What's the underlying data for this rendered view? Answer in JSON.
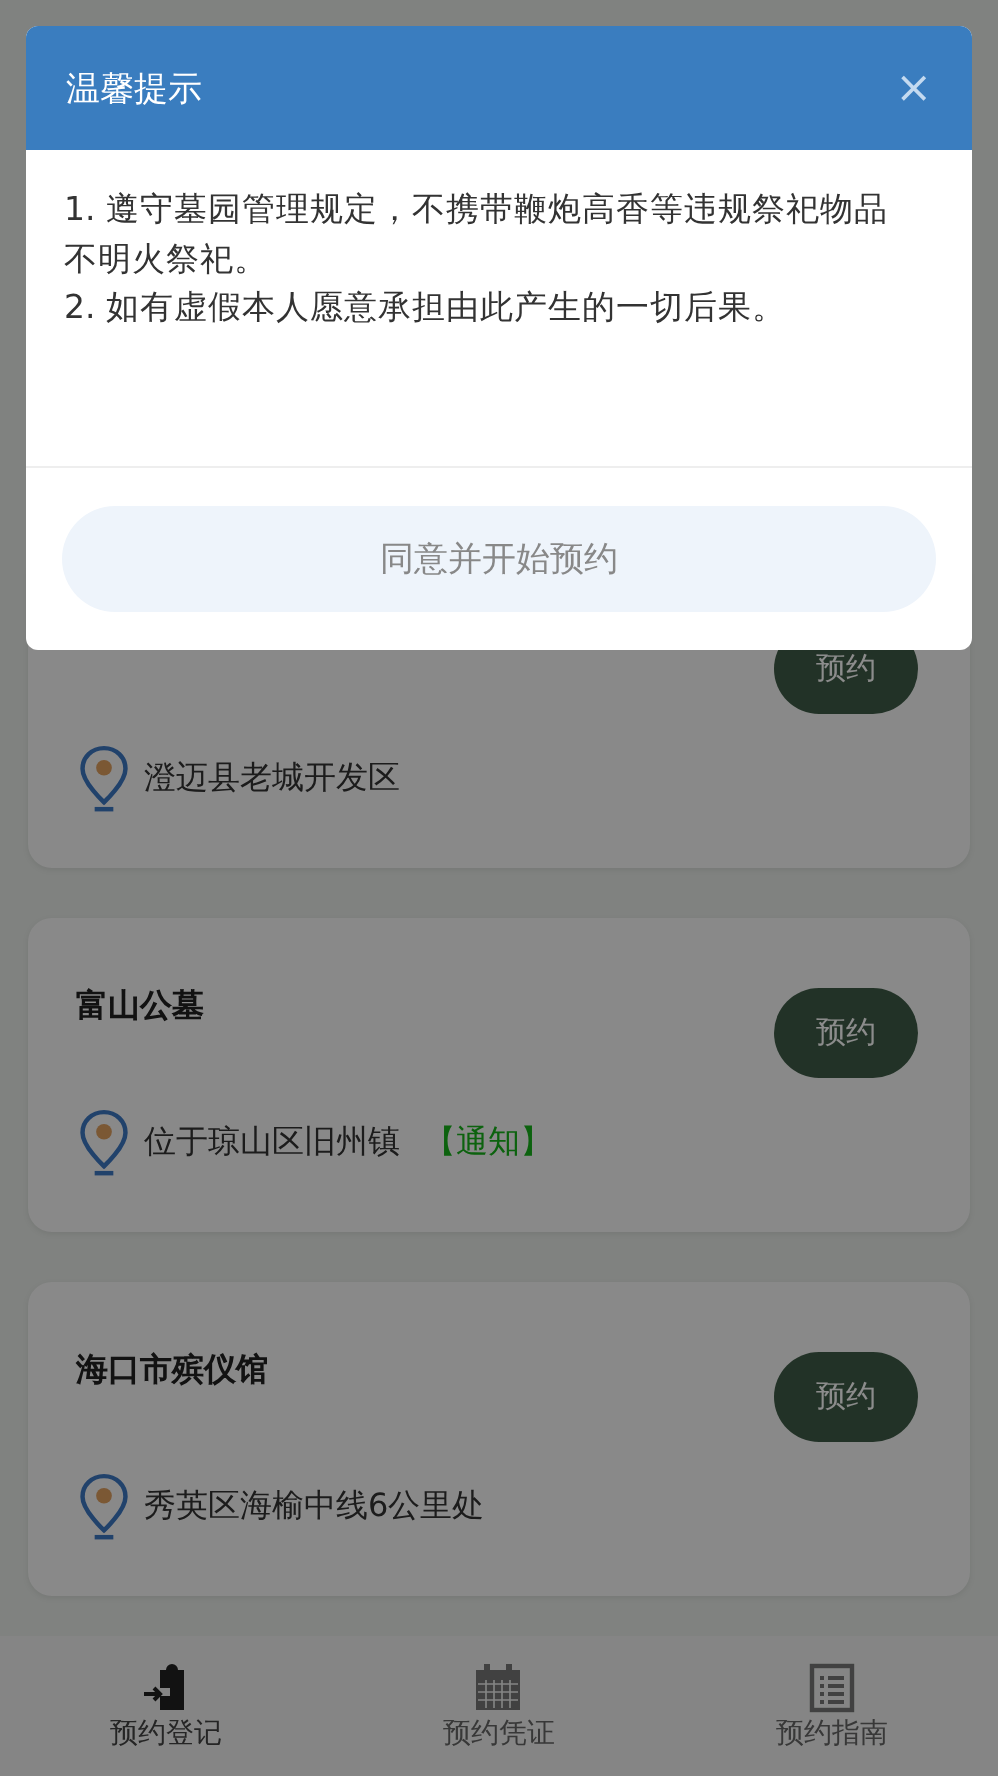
{
  "places": [
    {
      "button": "预约",
      "address": "澄迈县老城开发区"
    },
    {
      "name": "富山公墓",
      "button": "预约",
      "address": "位于琼山区旧州镇",
      "notice": "【通知】"
    },
    {
      "name": "海口市殡仪馆",
      "button": "预约",
      "address": "秀英区海榆中线6公里处"
    }
  ],
  "nav": [
    {
      "kind": "register",
      "label": "预约登记",
      "selected": true
    },
    {
      "kind": "calendar",
      "label": "预约凭证",
      "selected": false
    },
    {
      "kind": "guide",
      "label": "预约指南",
      "selected": false
    }
  ],
  "dialog": {
    "title": "温馨提示",
    "close": "×",
    "lines": [
      "1. 遵守墓园管理规定，不携带鞭炮高香等违规祭祀物品不明火祭祀。",
      "2. 如有虚假本人愿意承担由此产生的一切后果。"
    ],
    "button": "同意并开始预约"
  }
}
